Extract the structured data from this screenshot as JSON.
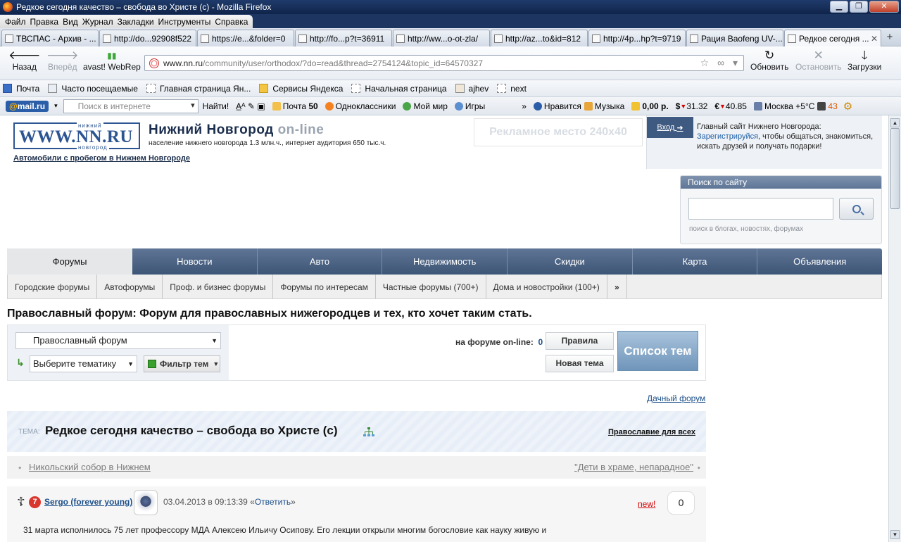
{
  "window": {
    "title": "Редкое сегодня качество – свобода во Христе (c) - Mozilla Firefox",
    "controls": [
      "▁",
      "❐",
      "✕"
    ]
  },
  "menu": [
    "Файл",
    "Правка",
    "Вид",
    "Журнал",
    "Закладки",
    "Инструменты",
    "Справка"
  ],
  "tabs": [
    "ТВСПАС - Архив - ...",
    "http://do...92908f522",
    "https://e...&folder=0",
    "http://fo...p?t=36911",
    "http://ww...o-ot-zla/",
    "http://az...to&id=812",
    "http://4p...hp?t=9719",
    "Рация Baofeng UV-...",
    "Редкое сегодня ..."
  ],
  "nav": {
    "back": "Назад",
    "forward": "Вперёд",
    "avast": "avast! WebRep",
    "reload": "Обновить",
    "stop": "Остановить",
    "downloads": "Загрузки",
    "url_host": "www.nn.ru",
    "url_path": "/community/user/orthodox/?do=read&thread=2754124&topic_id=64570327"
  },
  "bookmarks": [
    "Почта",
    "Часто посещаемые",
    "Главная страница Ян...",
    "Сервисы Яндекса",
    "Начальная страница",
    "ajhev",
    "next"
  ],
  "mailbar": {
    "logo_at": "@",
    "logo_text": "mail.ru",
    "search_placeholder": "Поиск в интернете",
    "find": "Найти!",
    "mail": "Почта",
    "mail_count": "50",
    "ok": "Одноклассники",
    "myworld": "Мой мир",
    "games": "Игры",
    "like": "Нравится",
    "music": "Музыка",
    "money": "0,00 р.",
    "usd": "31.32",
    "eur": "40.85",
    "weather": "Москва +5°C",
    "traffic": "43"
  },
  "site": {
    "logo_www": "WWW.NN.RU",
    "logo_top": "нижний",
    "logo_bottom": "новгород",
    "city": "Нижний Новгород",
    "online": "on-line",
    "subtitle": "население нижнего новгорода 1.3 млн.ч., интернет аудитория 650 тыс.ч.",
    "auto_link": "Автомобили с пробегом в Нижнем Новгороде",
    "ad": "Рекламное место 240x40",
    "login": "Вход",
    "login_text_1": "Главный сайт Нижнего Новгорода:",
    "register": "Зарегистрируйся",
    "login_text_2": ", чтобы общаться, знакомиться, искать друзей и получать подарки!",
    "search_title": "Поиск по сайту",
    "search_value": "",
    "search_hint": "поиск в блогах, новостях, форумах"
  },
  "main_nav": [
    "Форумы",
    "Новости",
    "Авто",
    "Недвижимость",
    "Скидки",
    "Карта",
    "Объявления"
  ],
  "sub_nav": [
    "Городские форумы",
    "Автофорумы",
    "Проф. и бизнес форумы",
    "Форумы по интересам",
    "Частные форумы (700+)",
    "Дома и новостройки (100+)"
  ],
  "forum": {
    "heading": "Православный форум: Форум для православных нижегородцев и тех, кто хочет таким стать.",
    "forum_select": "Православный форум",
    "topic_select": "Выберите тематику",
    "filter": "Фильтр тем",
    "online_label": "на форуме on-line:",
    "online_count": "0",
    "rules": "Правила",
    "new_topic": "Новая тема",
    "topic_list": "Список тем",
    "dach": "Дачный форум"
  },
  "topic": {
    "label": "ТЕМА:",
    "title": "Редкое сегодня качество – свобода во Христе (c)",
    "category": "Православие для всех",
    "prev": "Никольский собор в Нижнем",
    "next": "\"Дети в храме, непарадное\""
  },
  "post": {
    "rank": "7",
    "author": "Sergo (forever young)",
    "date": "03.04.2013 в 09:13:39 «",
    "reply": "Ответить",
    "date_end": "»",
    "new": "new!",
    "count": "0",
    "text": "31 марта исполнилось 75 лет профессору МДА Алексею Ильичу Осипову. Его лекции открыли многим богословие как науку живую и"
  }
}
